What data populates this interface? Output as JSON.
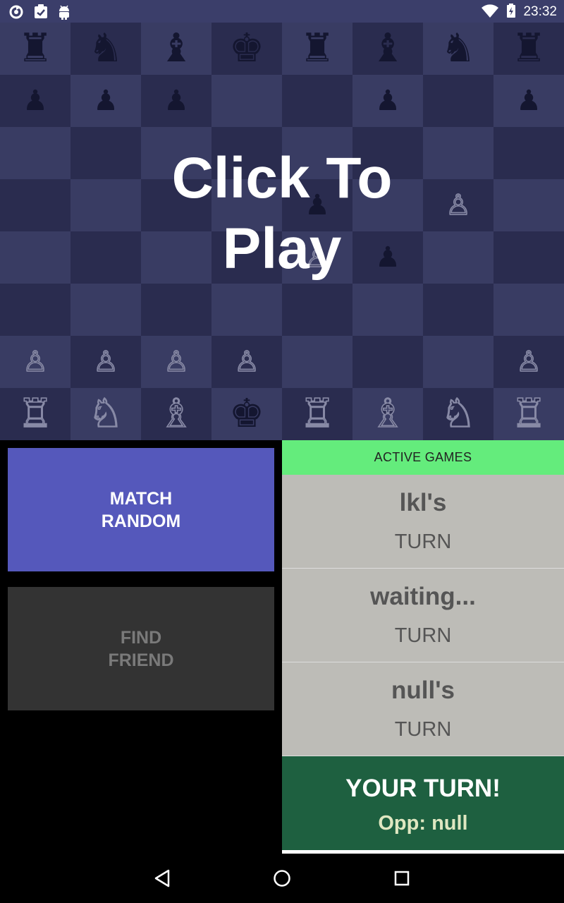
{
  "status_bar": {
    "time": "23:32",
    "left_icons": [
      "sync-icon",
      "clipboard-icon",
      "android-icon"
    ],
    "right_icons": [
      "wifi-icon",
      "battery-icon"
    ]
  },
  "board": {
    "ranks": [
      [
        {
          "p": "♜",
          "c": "black"
        },
        {
          "p": "♞",
          "c": "black"
        },
        {
          "p": "♝",
          "c": "black"
        },
        {
          "p": "♚",
          "c": "black"
        },
        {
          "p": "♜",
          "c": "black"
        },
        {
          "p": "♝",
          "c": "black"
        },
        {
          "p": "♞",
          "c": "black"
        },
        {
          "p": "♜",
          "c": "black"
        }
      ],
      [
        {
          "p": "♟",
          "c": "black"
        },
        {
          "p": "♟",
          "c": "black"
        },
        {
          "p": "♟",
          "c": "black"
        },
        {
          "p": "",
          "c": ""
        },
        {
          "p": "",
          "c": ""
        },
        {
          "p": "♟",
          "c": "black"
        },
        {
          "p": "",
          "c": ""
        },
        {
          "p": "♟",
          "c": "black"
        }
      ],
      [
        {
          "p": "",
          "c": ""
        },
        {
          "p": "",
          "c": ""
        },
        {
          "p": "",
          "c": ""
        },
        {
          "p": "",
          "c": ""
        },
        {
          "p": "",
          "c": ""
        },
        {
          "p": "",
          "c": ""
        },
        {
          "p": "",
          "c": ""
        },
        {
          "p": "",
          "c": ""
        }
      ],
      [
        {
          "p": "",
          "c": ""
        },
        {
          "p": "",
          "c": ""
        },
        {
          "p": "",
          "c": ""
        },
        {
          "p": "",
          "c": ""
        },
        {
          "p": "♟",
          "c": "black"
        },
        {
          "p": "",
          "c": ""
        },
        {
          "p": "♙",
          "c": "white"
        },
        {
          "p": "",
          "c": ""
        }
      ],
      [
        {
          "p": "",
          "c": ""
        },
        {
          "p": "",
          "c": ""
        },
        {
          "p": "",
          "c": ""
        },
        {
          "p": "",
          "c": ""
        },
        {
          "p": "♙",
          "c": "white"
        },
        {
          "p": "♟",
          "c": "black"
        },
        {
          "p": "",
          "c": ""
        },
        {
          "p": "",
          "c": ""
        }
      ],
      [
        {
          "p": "",
          "c": ""
        },
        {
          "p": "",
          "c": ""
        },
        {
          "p": "",
          "c": ""
        },
        {
          "p": "",
          "c": ""
        },
        {
          "p": "",
          "c": ""
        },
        {
          "p": "",
          "c": ""
        },
        {
          "p": "",
          "c": ""
        },
        {
          "p": "",
          "c": ""
        }
      ],
      [
        {
          "p": "♙",
          "c": "white"
        },
        {
          "p": "♙",
          "c": "white"
        },
        {
          "p": "♙",
          "c": "white"
        },
        {
          "p": "♙",
          "c": "white"
        },
        {
          "p": "",
          "c": ""
        },
        {
          "p": "",
          "c": ""
        },
        {
          "p": "",
          "c": ""
        },
        {
          "p": "♙",
          "c": "white"
        }
      ],
      [
        {
          "p": "♖",
          "c": "white"
        },
        {
          "p": "♘",
          "c": "white"
        },
        {
          "p": "♗",
          "c": "white"
        },
        {
          "p": "♚",
          "c": "black"
        },
        {
          "p": "♖",
          "c": "white"
        },
        {
          "p": "♗",
          "c": "white"
        },
        {
          "p": "♘",
          "c": "white"
        },
        {
          "p": "♖",
          "c": "white"
        }
      ]
    ],
    "overlay_text": "Click To Play"
  },
  "buttons": {
    "match_random": "MATCH\nRANDOM",
    "find_friend": "FIND\nFRIEND"
  },
  "active_games": {
    "header": "ACTIVE GAMES",
    "games": [
      {
        "name": "lkl's",
        "status": "TURN"
      },
      {
        "name": "waiting...",
        "status": "TURN"
      },
      {
        "name": "null's",
        "status": "TURN"
      }
    ],
    "your_turn": {
      "title": "YOUR TURN!",
      "opponent": "Opp: null"
    }
  },
  "nav": {
    "icons": [
      "back-icon",
      "home-icon",
      "recents-icon"
    ]
  },
  "colors": {
    "accent_match": "#5558bb",
    "header_green": "#64ec7c",
    "your_turn_green": "#1e6040"
  }
}
